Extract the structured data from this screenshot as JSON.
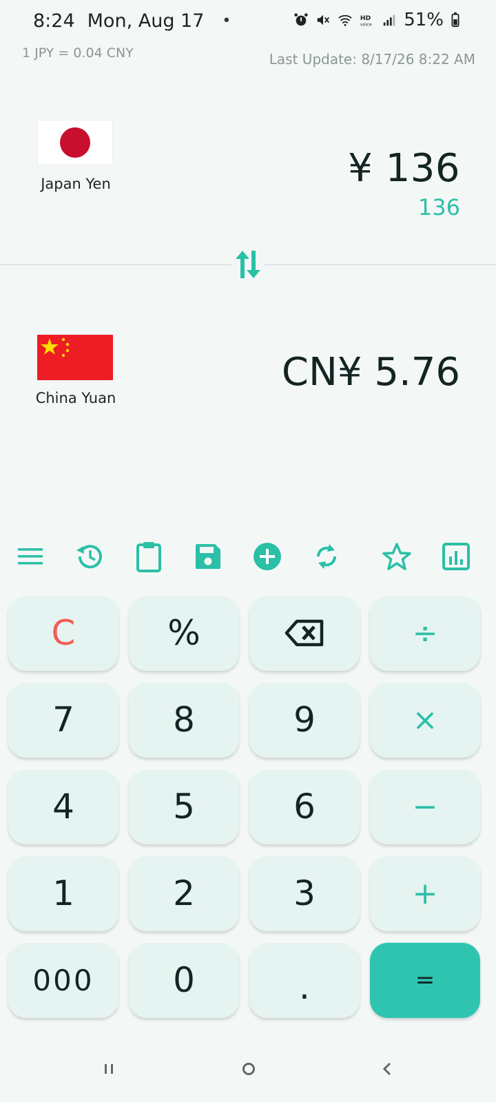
{
  "status": {
    "time": "8:24",
    "date": "Mon, Aug 17",
    "dot": "•",
    "battery": "51%"
  },
  "header": {
    "rate": "1 JPY = 0.04 CNY",
    "last_update": "Last Update: 8/17/26 8:22 AM"
  },
  "from": {
    "currency_name": "Japan Yen",
    "amount": "¥ 136",
    "input": "136",
    "flag_colors": {
      "bg": "#ffffff",
      "disc": "#c8102e"
    }
  },
  "to": {
    "currency_name": "China Yuan",
    "amount": "CN¥ 5.76",
    "flag_colors": {
      "bg": "#ee1c25",
      "stars": "#ffde00"
    }
  },
  "toolbar": {
    "icons": [
      "menu-icon",
      "history-icon",
      "clipboard-icon",
      "save-icon",
      "add-currency-icon",
      "refresh-icon",
      "favorite-icon",
      "chart-icon"
    ]
  },
  "keypad": {
    "clear": "C",
    "percent": "%",
    "divide": "÷",
    "k7": "7",
    "k8": "8",
    "k9": "9",
    "multiply": "×",
    "k4": "4",
    "k5": "5",
    "k6": "6",
    "minus": "−",
    "k1": "1",
    "k2": "2",
    "k3": "3",
    "plus": "+",
    "k000": "000",
    "k0": "0",
    "dot": ".",
    "equals": "="
  },
  "colors": {
    "accent": "#2bbfa7",
    "clear": "#f25c54",
    "key_bg": "#e6f4f1",
    "equals_bg": "#2ec4b0"
  }
}
